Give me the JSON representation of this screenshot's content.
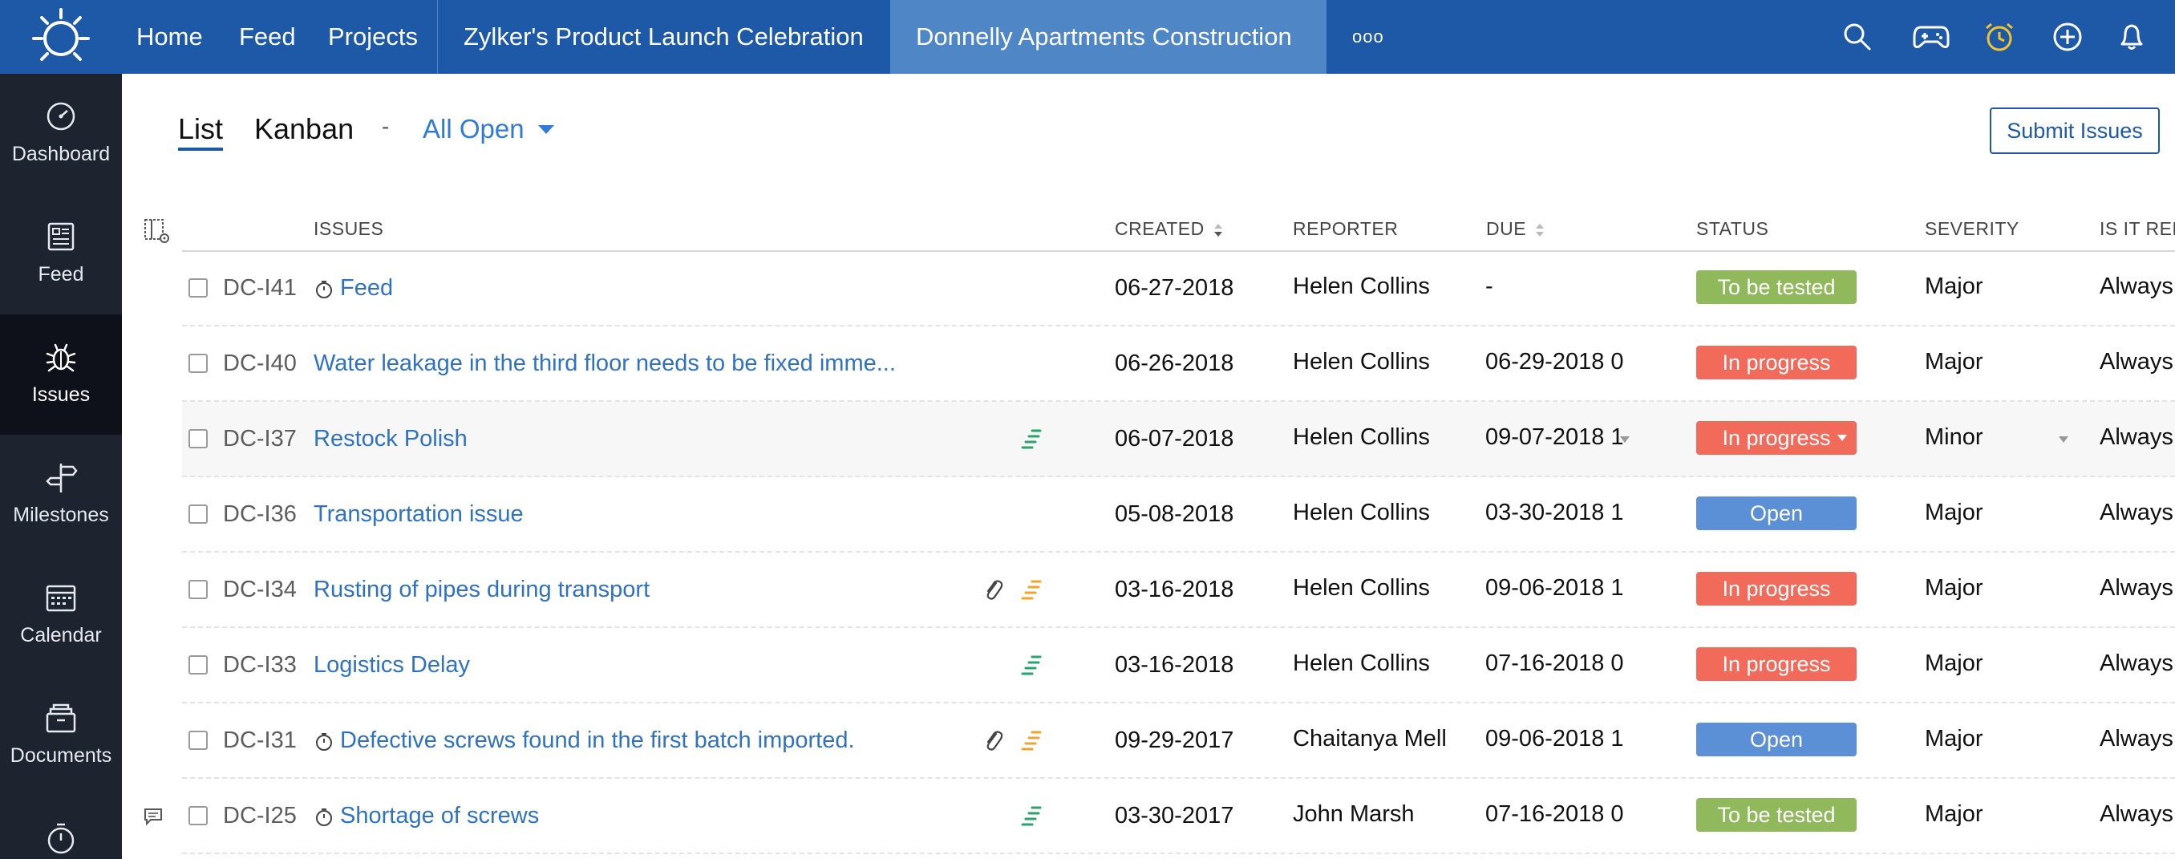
{
  "topbar": {
    "nav": [
      "Home",
      "Feed",
      "Projects"
    ],
    "tabs": [
      "Zylker's Product Launch Celebration",
      "Donnelly Apartments Construction"
    ],
    "more": "ooo",
    "icons": [
      "search-icon",
      "gamepad-icon",
      "alarm-clock-icon",
      "add-icon",
      "bell-icon"
    ],
    "brand_color": "#1d59a6",
    "active_tab_color": "#4f86c6"
  },
  "sidebar": {
    "items": [
      {
        "label": "Dashboard",
        "icon": "dashboard-icon"
      },
      {
        "label": "Feed",
        "icon": "feed-icon"
      },
      {
        "label": "Issues",
        "icon": "bug-icon",
        "active": true
      },
      {
        "label": "Milestones",
        "icon": "milestone-icon"
      },
      {
        "label": "Calendar",
        "icon": "calendar-icon"
      },
      {
        "label": "Documents",
        "icon": "documents-icon"
      },
      {
        "label": "",
        "icon": "timesheet-icon"
      }
    ]
  },
  "view": {
    "list_label": "List",
    "kanban_label": "Kanban",
    "separator": "-",
    "filter_label": "All Open",
    "submit_label": "Submit Issues"
  },
  "table": {
    "headers": {
      "issues": "ISSUES",
      "created": "CREATED",
      "reporter": "REPORTER",
      "due": "DUE",
      "status": "STATUS",
      "severity": "SEVERITY",
      "is_it_rep": "IS IT REP"
    },
    "rows": [
      {
        "id": "DC-I41",
        "title": "Feed",
        "clock": true,
        "created": "06-27-2018",
        "reporter": "Helen Collins",
        "due": "-",
        "status": "To be tested",
        "severity": "Major",
        "repro": "Always"
      },
      {
        "id": "DC-I40",
        "title": "Water leakage in the third floor needs to be fixed imme...",
        "clock": false,
        "created": "06-26-2018",
        "reporter": "Helen Collins",
        "due": "06-29-2018 0",
        "status": "In progress",
        "severity": "Major",
        "repro": "Always"
      },
      {
        "id": "DC-I37",
        "title": "Restock Polish",
        "clock": false,
        "priority": "green",
        "created": "06-07-2018",
        "reporter": "Helen Collins",
        "due": "09-07-2018 1",
        "status": "In progress",
        "severity": "Minor",
        "repro": "Always",
        "hover": true
      },
      {
        "id": "DC-I36",
        "title": "Transportation issue",
        "clock": false,
        "created": "05-08-2018",
        "reporter": "Helen Collins",
        "due": "03-30-2018 1",
        "status": "Open",
        "severity": "Major",
        "repro": "Always"
      },
      {
        "id": "DC-I34",
        "title": "Rusting of pipes during transport",
        "clock": false,
        "attachment": true,
        "priority": "orange",
        "created": "03-16-2018",
        "reporter": "Helen Collins",
        "due": "09-06-2018 1",
        "status": "In progress",
        "severity": "Major",
        "repro": "Always"
      },
      {
        "id": "DC-I33",
        "title": "Logistics Delay",
        "clock": false,
        "priority": "green",
        "created": "03-16-2018",
        "reporter": "Helen Collins",
        "due": "07-16-2018 0",
        "status": "In progress",
        "severity": "Major",
        "repro": "Always"
      },
      {
        "id": "DC-I31",
        "title": "Defective screws found in the first batch imported.",
        "clock": true,
        "attachment": true,
        "priority": "orange",
        "created": "09-29-2017",
        "reporter": "Chaitanya Mell",
        "due": "09-06-2018 1",
        "status": "Open",
        "severity": "Major",
        "repro": "Always"
      },
      {
        "id": "DC-I25",
        "title": "Shortage of screws",
        "clock": true,
        "priority": "green",
        "comment": true,
        "created": "03-30-2017",
        "reporter": "John Marsh",
        "due": "07-16-2018 0",
        "status": "To be tested",
        "severity": "Major",
        "repro": "Always"
      }
    ]
  },
  "status_colors": {
    "To be tested": "#8fb95b",
    "In progress": "#f26a5a",
    "Open": "#5b8fd6"
  }
}
